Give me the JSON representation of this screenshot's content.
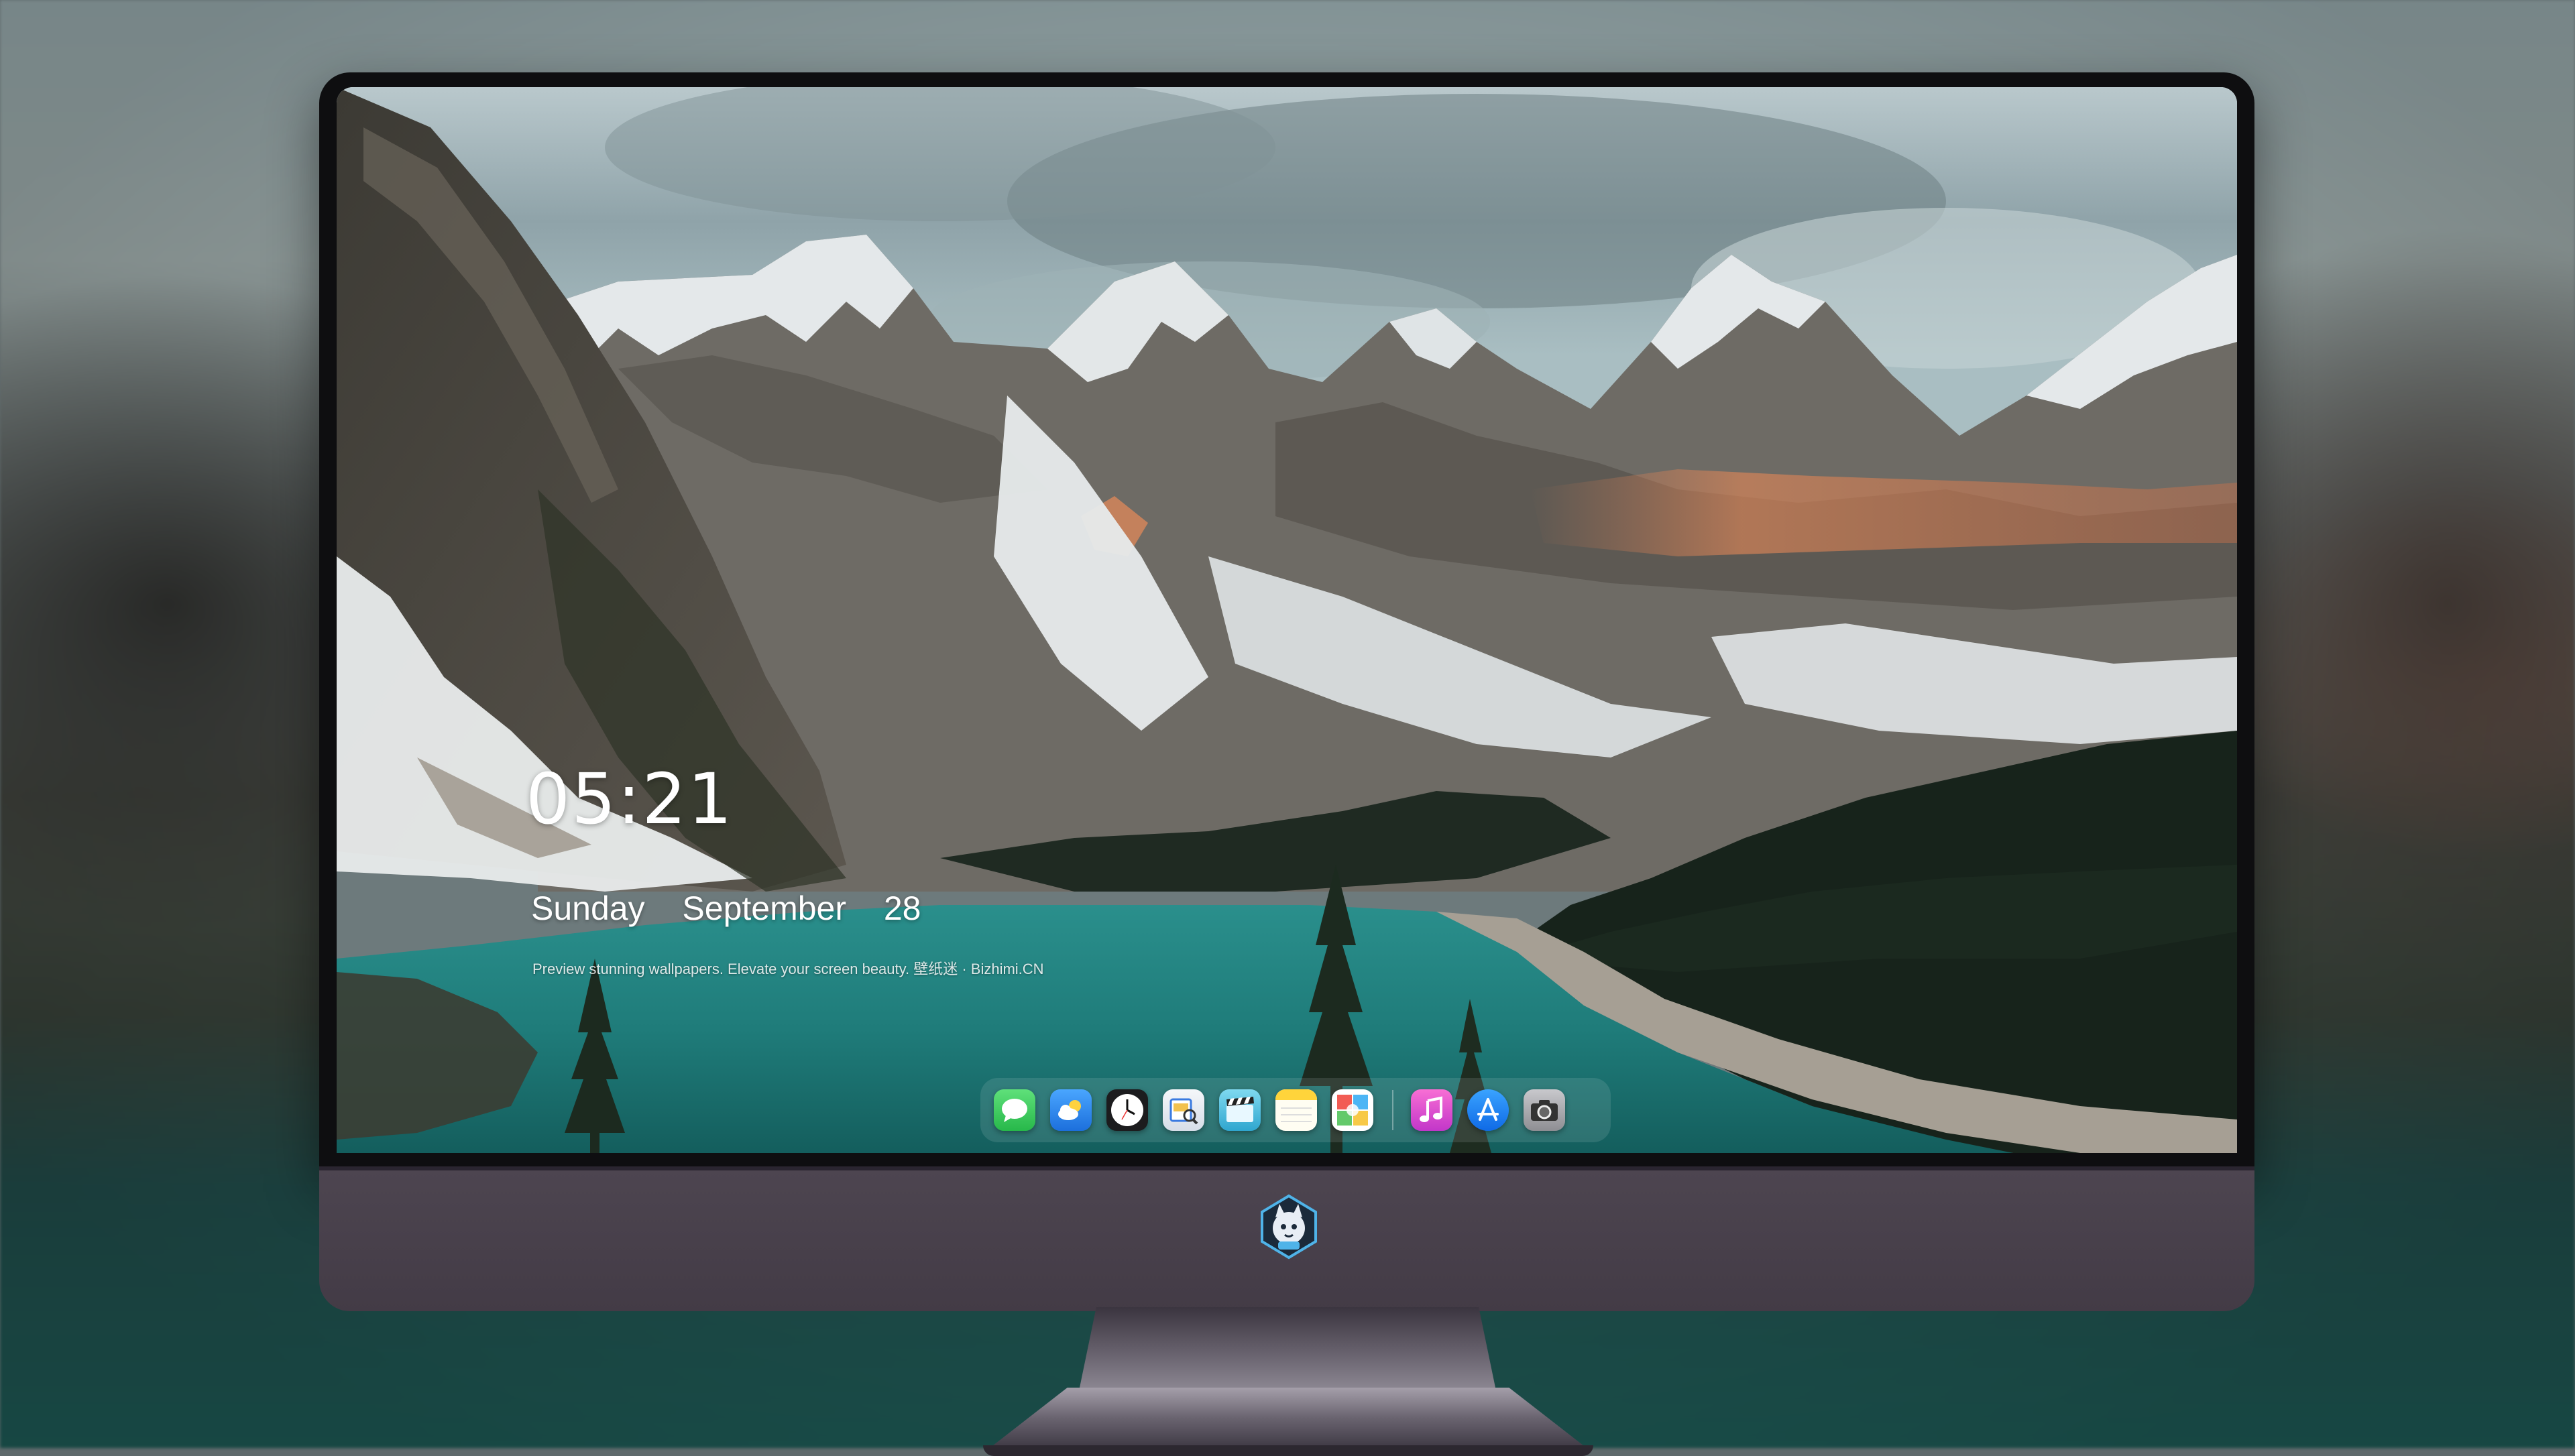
{
  "lockscreen": {
    "time": "05:21",
    "weekday": "Sunday",
    "month": "September",
    "day": "28",
    "caption": "Preview stunning wallpapers. Elevate your screen beauty. 壁纸迷 · Bizhimi.CN"
  },
  "dock": {
    "apps": [
      {
        "icon": "messages-icon",
        "color": "#34c759"
      },
      {
        "icon": "weather-icon",
        "color": "#2f8bf0"
      },
      {
        "icon": "clock-icon",
        "color": "#1c1c1e"
      },
      {
        "icon": "preview-icon",
        "color": "#e9eef5"
      },
      {
        "icon": "video-editor-icon",
        "color": "#3fb8d8"
      },
      {
        "icon": "notes-icon",
        "color": "#ffd43b"
      },
      {
        "icon": "photo-gallery-icon",
        "color": "#ffffff"
      }
    ],
    "apps_right": [
      {
        "icon": "music-icon",
        "color": "#e03fd0"
      },
      {
        "icon": "app-store-icon",
        "color": "#1e7cf2"
      },
      {
        "icon": "camera-icon",
        "color": "#8e8e93"
      }
    ]
  },
  "chin": {
    "logo": "mascot-logo-icon"
  }
}
